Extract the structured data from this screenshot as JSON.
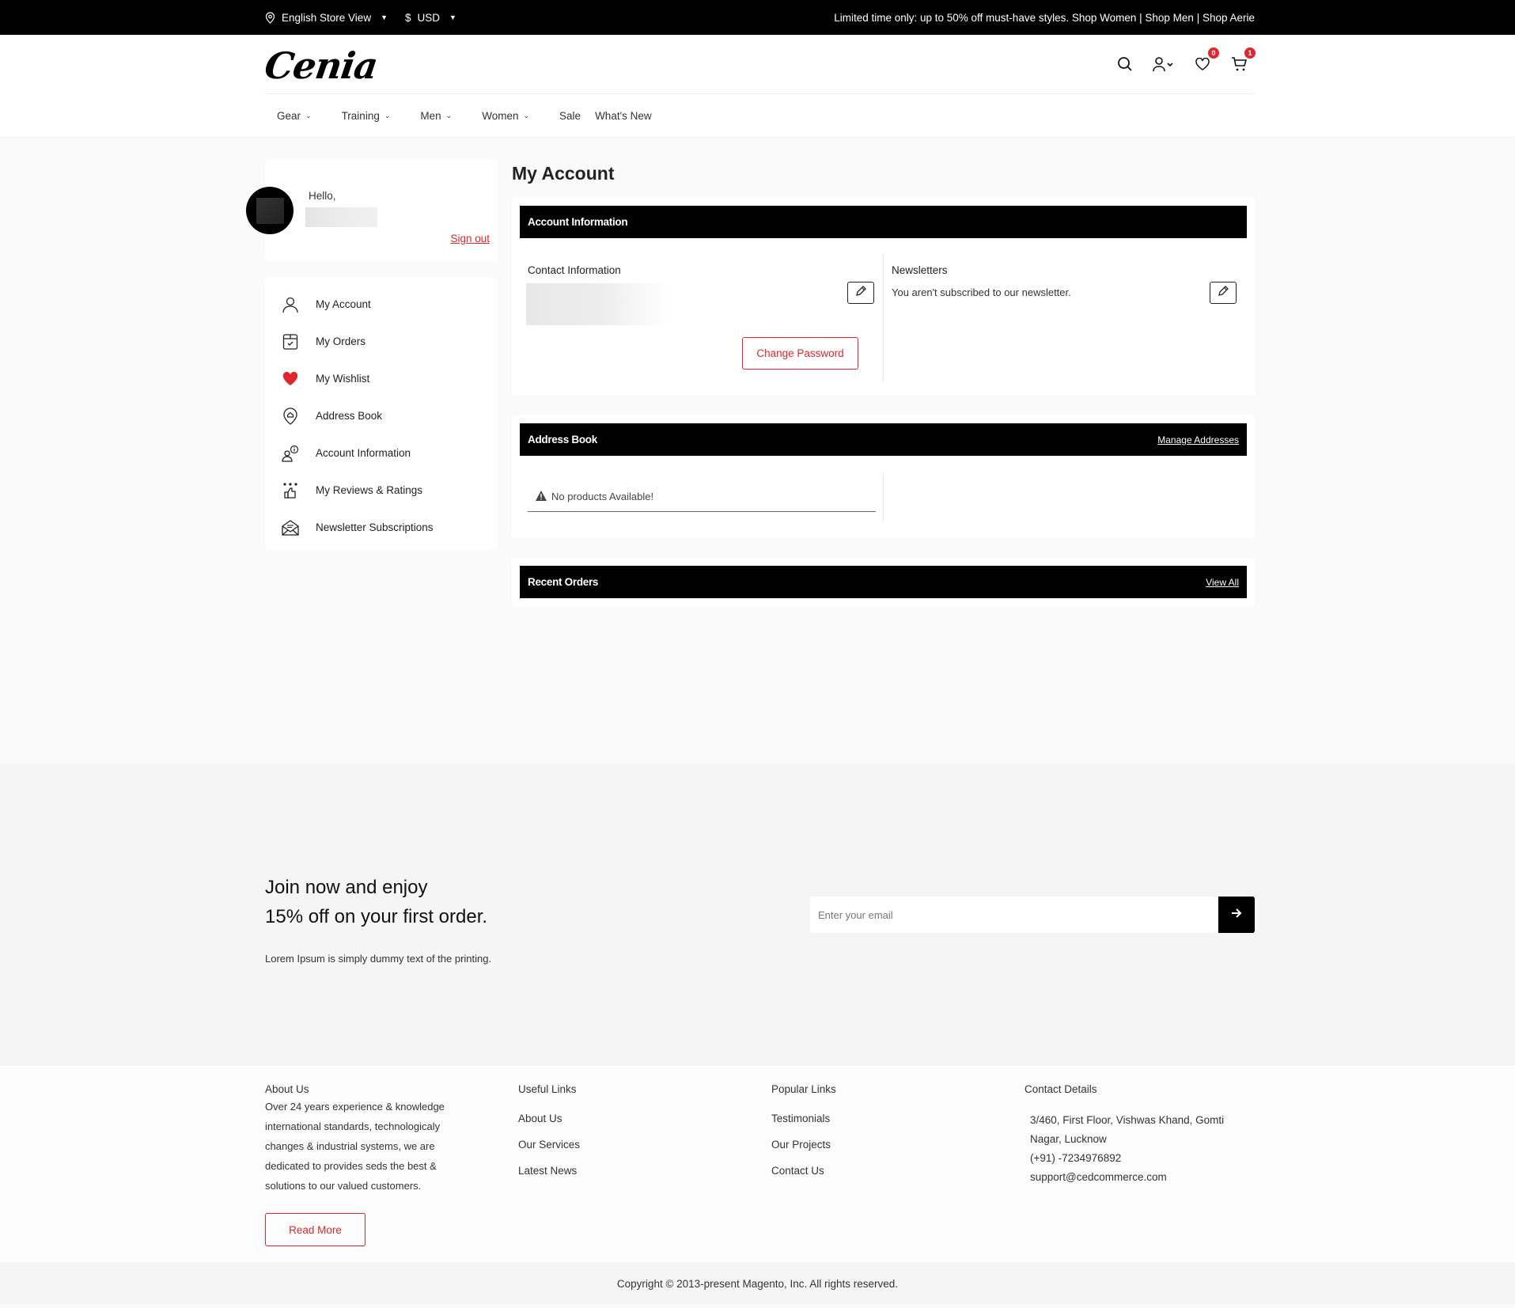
{
  "topbar": {
    "store_view": "English Store View",
    "currency": "USD",
    "currency_symbol": "$",
    "promo": "Limited time only: up to 50% off must-have styles. Shop Women | Shop Men | Shop Aerie"
  },
  "header": {
    "logo": "Cenia",
    "wishlist_count": "0",
    "cart_count": "1",
    "icons": [
      "search-icon",
      "account-icon",
      "wishlist-icon",
      "cart-icon"
    ]
  },
  "nav": {
    "items": [
      {
        "label": "Gear",
        "dropdown": true
      },
      {
        "label": "Training",
        "dropdown": true
      },
      {
        "label": "Men",
        "dropdown": true
      },
      {
        "label": "Women",
        "dropdown": true
      },
      {
        "label": "Sale",
        "dropdown": false
      },
      {
        "label": "What's New",
        "dropdown": false
      }
    ]
  },
  "sidebar": {
    "greeting": "Hello,",
    "sign_out": "Sign out",
    "items": [
      {
        "label": "My Account",
        "icon": "user-icon"
      },
      {
        "label": "My Orders",
        "icon": "order-box-icon"
      },
      {
        "label": "My Wishlist",
        "icon": "heart-icon"
      },
      {
        "label": "Address Book",
        "icon": "location-pin-icon"
      },
      {
        "label": "Account Information",
        "icon": "user-info-icon"
      },
      {
        "label": "My Reviews & Ratings",
        "icon": "thumbs-up-stars-icon"
      },
      {
        "label": "Newsletter Subscriptions",
        "icon": "envelope-icon"
      }
    ]
  },
  "main": {
    "title": "My Account",
    "account_info": {
      "heading": "Account Information",
      "contact_title": "Contact Information",
      "change_password": "Change Password",
      "newsletters_title": "Newsletters",
      "newsletters_text": "You aren't subscribed to our newsletter."
    },
    "address_book": {
      "heading": "Address Book",
      "manage_link": "Manage Addresses",
      "empty_message": "No products Available!"
    },
    "recent_orders": {
      "heading": "Recent Orders",
      "view_all": "View All"
    }
  },
  "newsletter": {
    "title_line1": "Join now and enjoy",
    "title_line2": "15% off on your first order.",
    "subtitle": "Lorem Ipsum is simply dummy text of the printing.",
    "email_placeholder": "Enter your email"
  },
  "footer": {
    "about": {
      "heading": "About Us",
      "text": "Over 24 years experience & knowledge international standards, technologicaly changes & industrial systems, we are dedicated to provides seds the best & solutions to our valued customers.",
      "read_more": "Read More"
    },
    "useful_links": {
      "heading": "Useful Links",
      "links": [
        "About Us",
        "Our Services",
        "Latest News"
      ]
    },
    "popular_links": {
      "heading": "Popular Links",
      "links": [
        "Testimonials",
        "Our Projects",
        "Contact Us"
      ]
    },
    "contact": {
      "heading": "Contact Details",
      "address": "3/460, First Floor, Vishwas Khand, Gomti Nagar, Lucknow",
      "phone": "(+91) -7234976892",
      "email": "support@cedcommerce.com"
    },
    "copyright": "Copyright © 2013-present Magento, Inc. All rights reserved."
  },
  "colors": {
    "accent": "#e0262e",
    "dark": "#000000",
    "page_bg": "#fafafa"
  }
}
